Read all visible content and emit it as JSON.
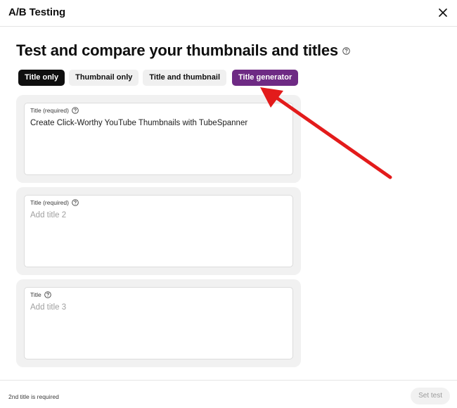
{
  "dialog": {
    "title": "A/B Testing"
  },
  "page": {
    "title": "Test and compare your thumbnails and titles"
  },
  "tabs": [
    {
      "label": "Title only",
      "active": true
    },
    {
      "label": "Thumbnail only",
      "active": false
    },
    {
      "label": "Title and thumbnail",
      "active": false
    },
    {
      "label": "Title generator",
      "active": false
    }
  ],
  "fields": [
    {
      "label": "Title (required)",
      "value": "Create Click-Worthy YouTube Thumbnails with TubeSpanner",
      "placeholder": ""
    },
    {
      "label": "Title (required)",
      "value": "",
      "placeholder": "Add title 2"
    },
    {
      "label": "Title",
      "value": "",
      "placeholder": "Add title 3"
    }
  ],
  "footer": {
    "message": "2nd title is required",
    "set_test_label": "Set test"
  },
  "colors": {
    "generator_tab": "#6e2a84",
    "active_tab": "#0f0f0f",
    "arrow": "#e31b1b"
  },
  "icons": {
    "close": "close-icon",
    "help": "help-circle-icon"
  }
}
